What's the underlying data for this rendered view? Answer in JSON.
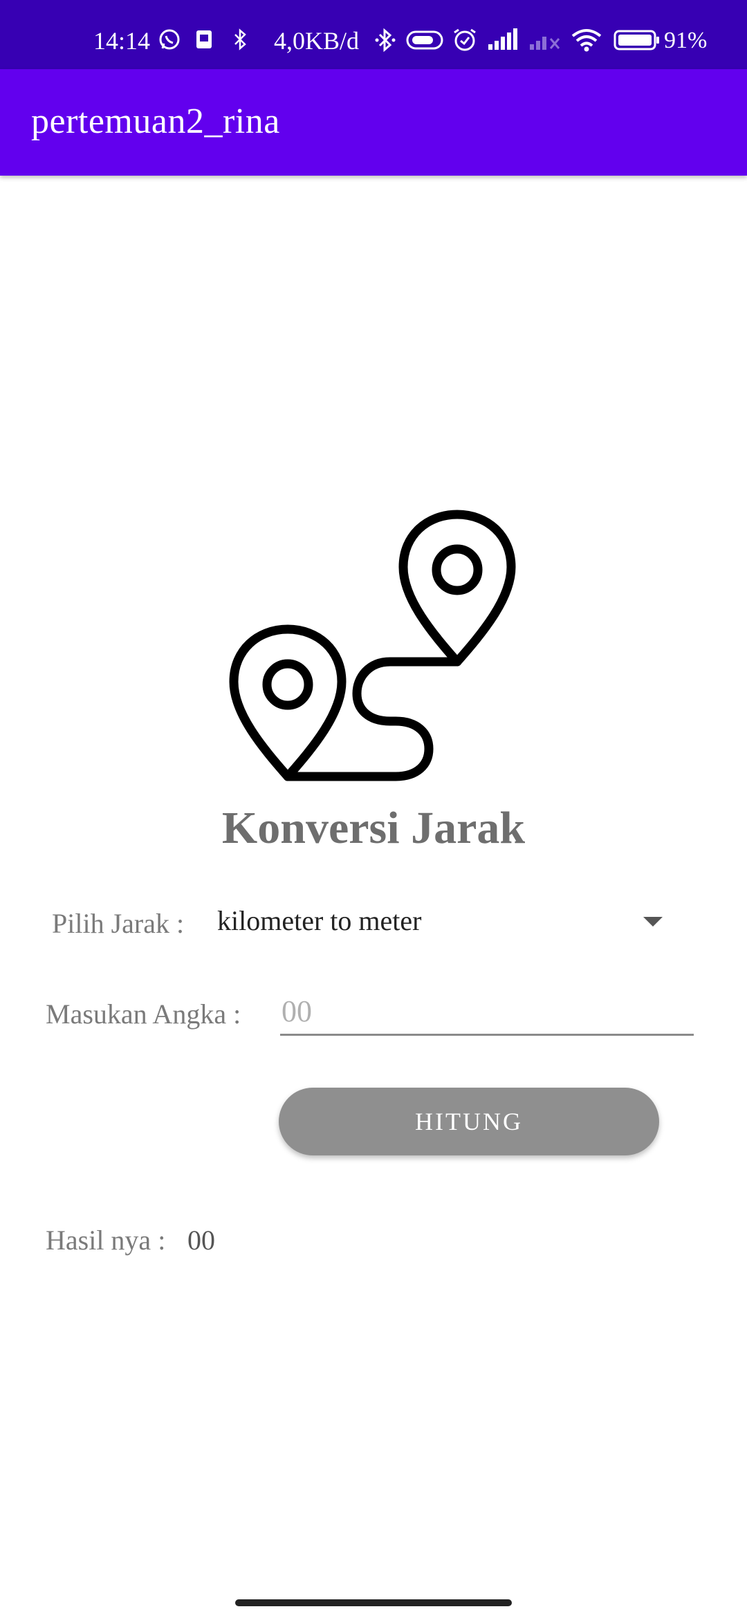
{
  "status_bar": {
    "time": "14:14",
    "network_speed": "4,0KB/d",
    "battery_percent": "91%",
    "icons": [
      "whatsapp-icon",
      "sim-card-icon",
      "bluetooth-icon",
      "bluetooth-icon",
      "vpn-icon",
      "alarm-icon",
      "signal-icon",
      "signal-empty-icon",
      "wifi-icon",
      "battery-icon"
    ],
    "color": "#3700b3"
  },
  "app_bar": {
    "title": "pertemuan2_rina",
    "color": "#6200ee"
  },
  "main": {
    "illustration_icon": "map-route-pins-icon",
    "heading": "Konversi Jarak",
    "distance_selector": {
      "label": "Pilih Jarak :",
      "selected_value": "kilometer to meter"
    },
    "number_input": {
      "label": "Masukan Angka :",
      "placeholder": "00",
      "value": ""
    },
    "calculate_button": {
      "label": "HITUNG",
      "color": "#8f8f8f"
    },
    "result": {
      "label": "Hasil nya :",
      "value": "00"
    }
  }
}
